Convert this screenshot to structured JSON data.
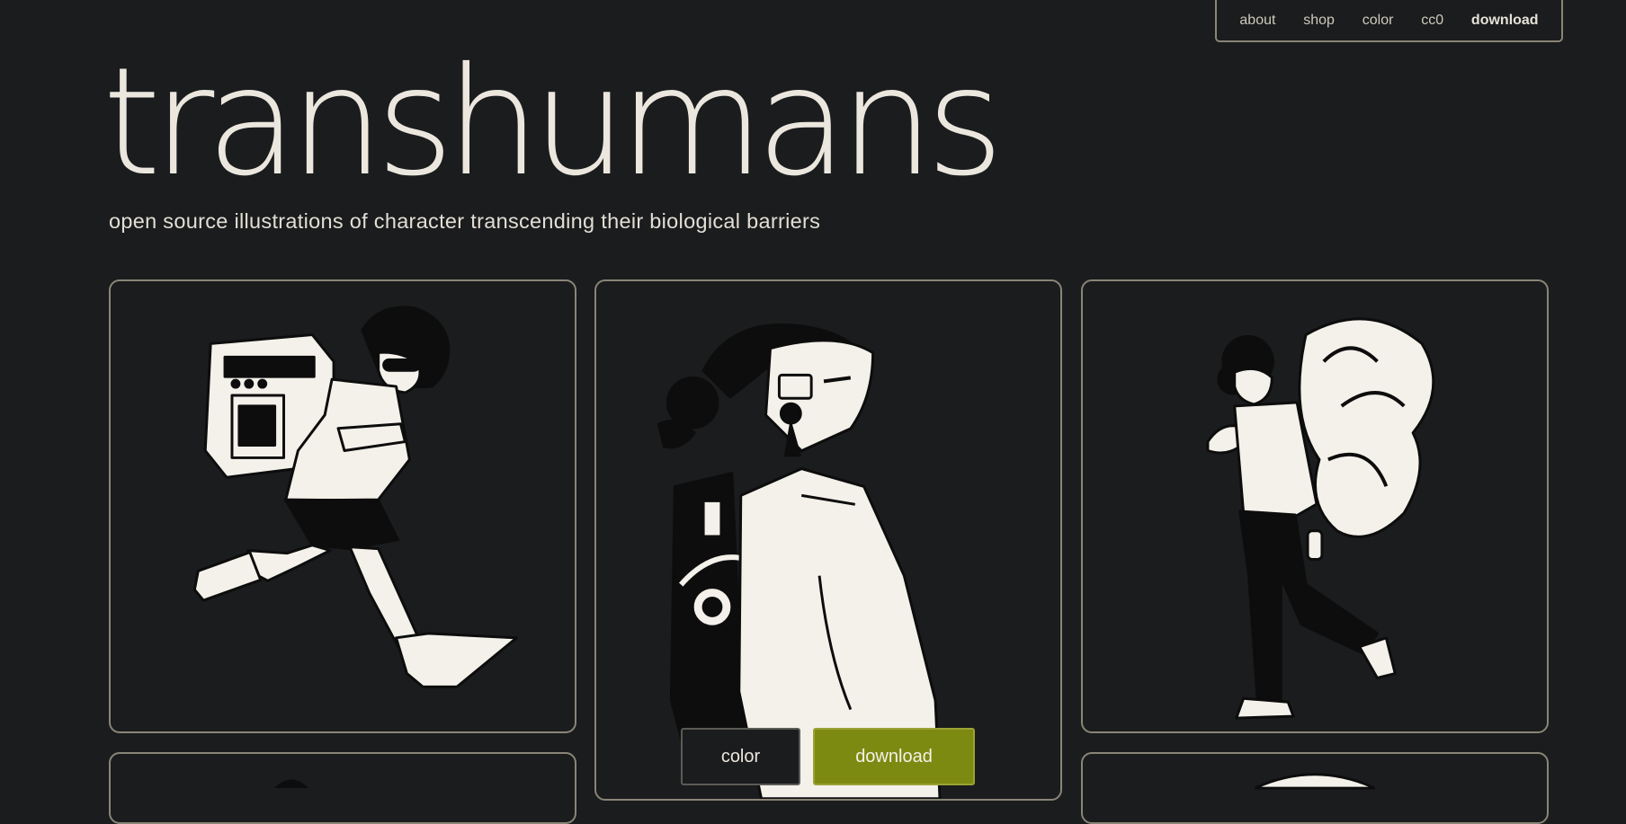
{
  "nav": {
    "items": [
      {
        "label": "about"
      },
      {
        "label": "shop"
      },
      {
        "label": "color"
      },
      {
        "label": "cc0"
      },
      {
        "label": "download"
      }
    ]
  },
  "header": {
    "title": "transhumans",
    "subtitle": "open source illustrations of character transcending their biological barriers"
  },
  "gallery": {
    "cards": [
      {
        "illustration": "running-character-with-robot-backpack"
      },
      {
        "illustration": "character-with-machine-backpack-looking-up"
      },
      {
        "illustration": "walking-character-with-plant-backpack"
      },
      {
        "illustration": "partial-illustration"
      },
      {
        "illustration": "partial-illustration"
      }
    ]
  },
  "actions": {
    "color_label": "color",
    "download_label": "download"
  },
  "colors": {
    "background": "#1a1c1d",
    "border": "#8a8577",
    "text": "#ece7de",
    "download_accent": "#7d8a12"
  }
}
